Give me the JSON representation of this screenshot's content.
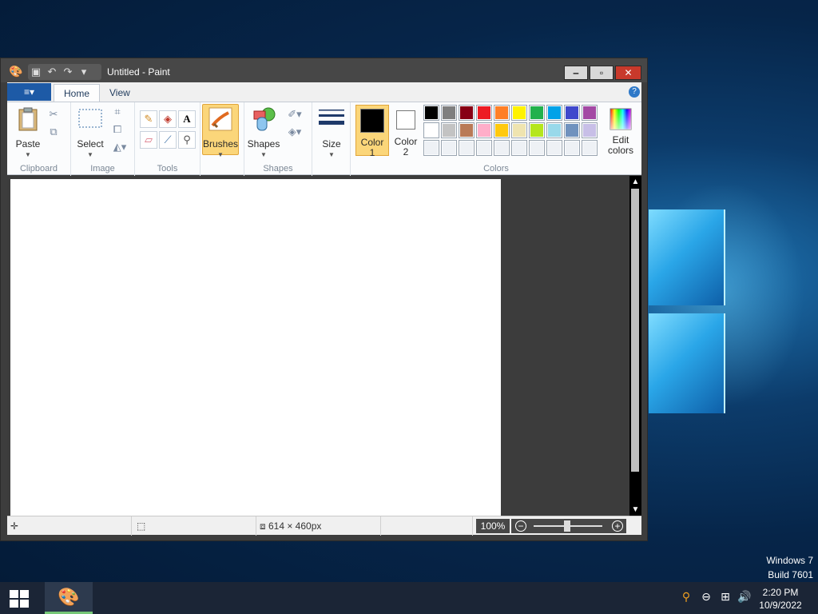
{
  "window": {
    "title": "Untitled - Paint",
    "qat_icons": [
      "save-icon",
      "undo-icon",
      "redo-icon",
      "customize-icon"
    ]
  },
  "tabs": {
    "file_label": "≡▾",
    "home": "Home",
    "view": "View",
    "help": "?"
  },
  "ribbon": {
    "clipboard": {
      "label": "Clipboard",
      "paste": "Paste"
    },
    "image": {
      "label": "Image",
      "select": "Select"
    },
    "tools": {
      "label": "Tools"
    },
    "brushes": "Brushes",
    "shapes": {
      "label": "Shapes",
      "button": "Shapes"
    },
    "size": "Size",
    "colors": {
      "label": "Colors",
      "color1_line1": "Color",
      "color1_line2": "1",
      "color2_line1": "Color",
      "color2_line2": "2",
      "edit_line1": "Edit",
      "edit_line2": "colors",
      "color1": "#000000",
      "color2": "#ffffff",
      "palette_row1": [
        "#000000",
        "#7f7f7f",
        "#880015",
        "#ed1c24",
        "#ff7f27",
        "#fff200",
        "#22b14c",
        "#00a2e8",
        "#3f48cc",
        "#a349a4"
      ],
      "palette_row2": [
        "#ffffff",
        "#c3c3c3",
        "#b97a57",
        "#ffaec9",
        "#ffc90e",
        "#efe4b0",
        "#b5e61d",
        "#99d9ea",
        "#7092be",
        "#c8bfe7"
      ]
    }
  },
  "status": {
    "canvas_size": "614 × 460px",
    "zoom": "100%"
  },
  "desktop": {
    "watermark_line1": "Windows 7",
    "watermark_line2": "Build 7601"
  },
  "taskbar": {
    "time": "2:20 PM",
    "date": "10/9/2022"
  }
}
